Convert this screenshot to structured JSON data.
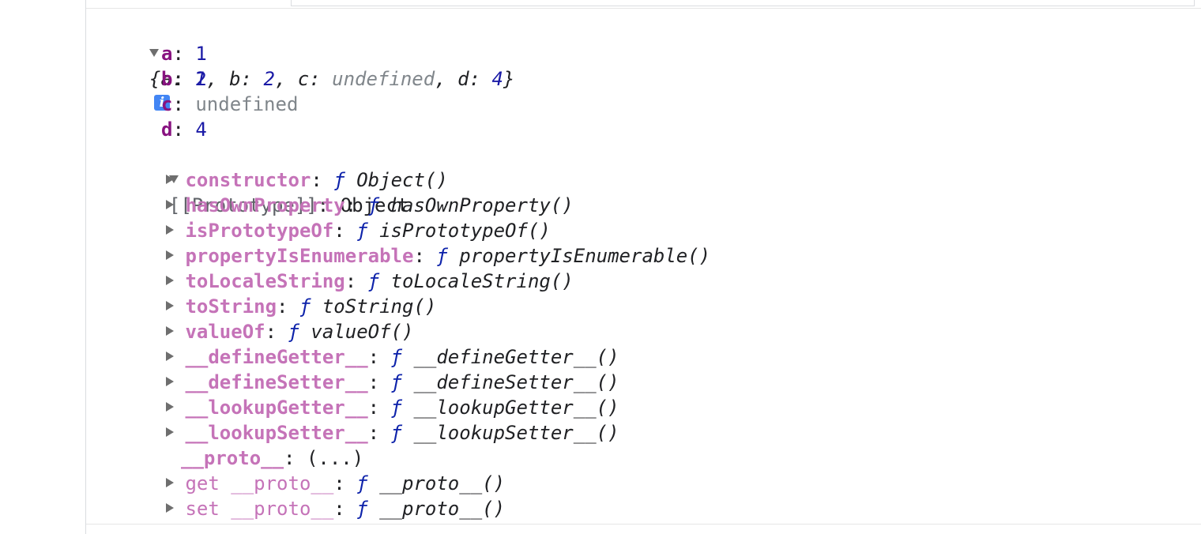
{
  "summary": {
    "open": "{",
    "close": "}",
    "sep": ", ",
    "colon": ": ",
    "pairs": [
      {
        "key": "a",
        "value": "1"
      },
      {
        "key": "b",
        "value": "2"
      },
      {
        "key": "c",
        "value": "undefined"
      },
      {
        "key": "d",
        "value": "4"
      }
    ],
    "info_icon": "info-icon",
    "info_glyph": "i"
  },
  "own_properties": [
    {
      "key": "a",
      "value": "1"
    },
    {
      "key": "b",
      "value": "2"
    },
    {
      "key": "c",
      "value": "undefined"
    },
    {
      "key": "d",
      "value": "4"
    }
  ],
  "prototype": {
    "label": "[[Prototype]]",
    "colon": ": ",
    "value": "Object"
  },
  "f_keyword": "ƒ",
  "proto_members": [
    {
      "key": "constructor",
      "func": "Object()"
    },
    {
      "key": "hasOwnProperty",
      "func": "hasOwnProperty()"
    },
    {
      "key": "isPrototypeOf",
      "func": "isPrototypeOf()"
    },
    {
      "key": "propertyIsEnumerable",
      "func": "propertyIsEnumerable()"
    },
    {
      "key": "toLocaleString",
      "func": "toLocaleString()"
    },
    {
      "key": "toString",
      "func": "toString()"
    },
    {
      "key": "valueOf",
      "func": "valueOf()"
    },
    {
      "key": "__defineGetter__",
      "func": "__defineGetter__()"
    },
    {
      "key": "__defineSetter__",
      "func": "__defineSetter__()"
    },
    {
      "key": "__lookupGetter__",
      "func": "__lookupGetter__()"
    },
    {
      "key": "__lookupSetter__",
      "func": "__lookupSetter__()"
    }
  ],
  "proto_getter_row": {
    "key": "__proto__",
    "value": "(...)"
  },
  "accessors": [
    {
      "key": "get __proto__",
      "func": "__proto__()"
    },
    {
      "key": "set __proto__",
      "func": "__proto__()"
    }
  ],
  "colors": {
    "own_key": "#881280",
    "proto_key": "#c573b8",
    "number": "#1a1aa6",
    "undefined": "#80868b",
    "f_keyword": "#0d22aa",
    "info_icon": "#4285f4"
  }
}
